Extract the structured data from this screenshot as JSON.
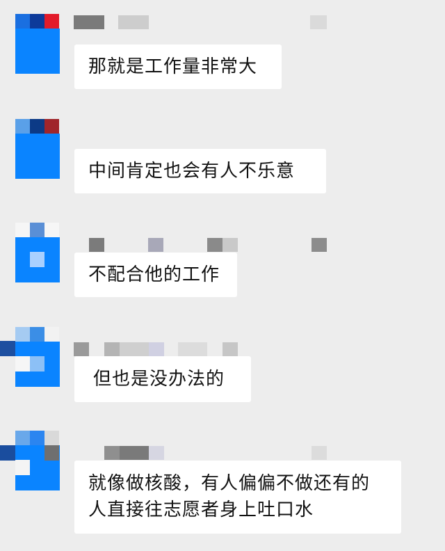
{
  "messages": [
    {
      "text_lines": [
        "那就是工作量非常大"
      ]
    },
    {
      "text_lines": [
        "中间肯定也会有人不乐意"
      ]
    },
    {
      "text_lines": [
        "不配合他的工作"
      ]
    },
    {
      "text_lines": [
        "但也是没办法的"
      ]
    },
    {
      "text_lines": [
        "就像做核酸，有人偏偏不做还有的",
        "人直接往志愿者身上吐口水"
      ]
    }
  ],
  "colors": {
    "background": "#ededed",
    "bubble": "#ffffff",
    "avatar_blue": "#0a84ff"
  },
  "icons": {
    "avatar": "avatar-pixelated",
    "name": "sender-name-pixelated"
  }
}
